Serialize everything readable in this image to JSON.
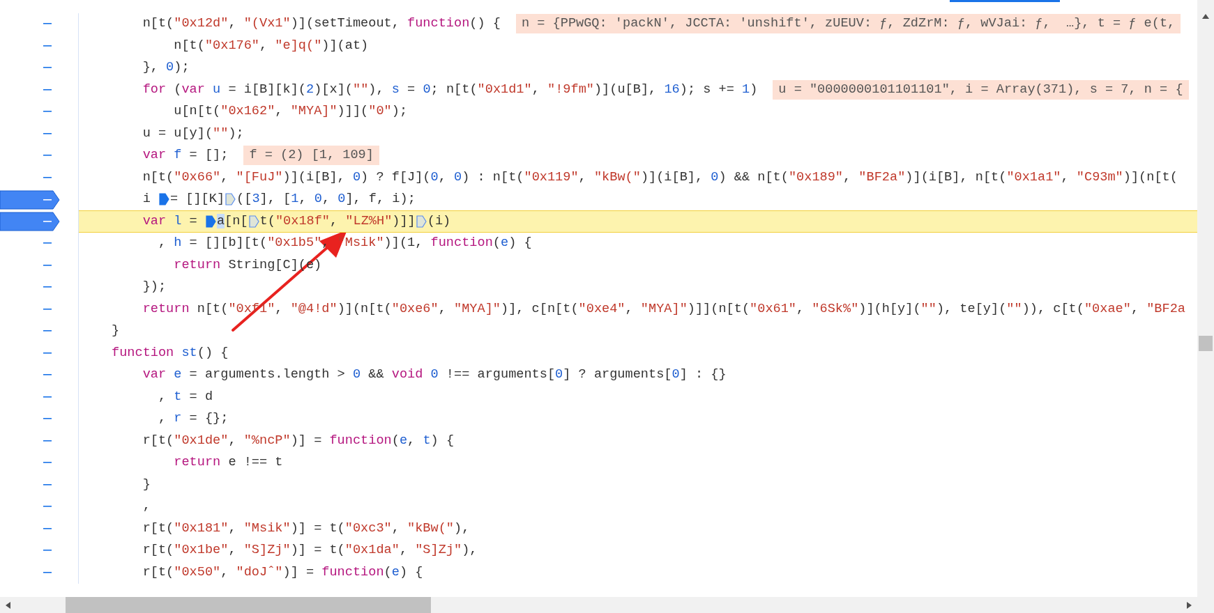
{
  "code_lines": [
    {
      "breakpoint": false,
      "current": false,
      "segments": [
        {
          "kind": "plain",
          "text": "    n[t("
        },
        {
          "kind": "string",
          "text": "\"0x12d\""
        },
        {
          "kind": "plain",
          "text": ", "
        },
        {
          "kind": "string",
          "text": "\"(Vx1\""
        },
        {
          "kind": "plain",
          "text": ")](setTimeout, "
        },
        {
          "kind": "keyword",
          "text": "function"
        },
        {
          "kind": "plain",
          "text": "() {"
        },
        {
          "kind": "value",
          "text": "n = {PPwGQ: 'packN', JCCTA: 'unshift', zUEUV: ƒ, ZdZrM: ƒ, wVJai: ƒ,  …}, t = ƒ e(t,"
        }
      ]
    },
    {
      "breakpoint": false,
      "current": false,
      "segments": [
        {
          "kind": "plain",
          "text": "        n[t("
        },
        {
          "kind": "string",
          "text": "\"0x176\""
        },
        {
          "kind": "plain",
          "text": ", "
        },
        {
          "kind": "string",
          "text": "\"e]q(\""
        },
        {
          "kind": "plain",
          "text": ")](at)"
        }
      ]
    },
    {
      "breakpoint": false,
      "current": false,
      "segments": [
        {
          "kind": "plain",
          "text": "    }, "
        },
        {
          "kind": "number",
          "text": "0"
        },
        {
          "kind": "plain",
          "text": ");"
        }
      ]
    },
    {
      "breakpoint": false,
      "current": false,
      "segments": [
        {
          "kind": "keyword",
          "text": "    for"
        },
        {
          "kind": "plain",
          "text": " ("
        },
        {
          "kind": "keyword",
          "text": "var "
        },
        {
          "kind": "name",
          "text": "u"
        },
        {
          "kind": "plain",
          "text": " = i[B][k]("
        },
        {
          "kind": "number",
          "text": "2"
        },
        {
          "kind": "plain",
          "text": ")[x]("
        },
        {
          "kind": "string",
          "text": "\"\""
        },
        {
          "kind": "plain",
          "text": "), "
        },
        {
          "kind": "name",
          "text": "s"
        },
        {
          "kind": "plain",
          "text": " = "
        },
        {
          "kind": "number",
          "text": "0"
        },
        {
          "kind": "plain",
          "text": "; n[t("
        },
        {
          "kind": "string",
          "text": "\"0x1d1\""
        },
        {
          "kind": "plain",
          "text": ", "
        },
        {
          "kind": "string",
          "text": "\"!9fm\""
        },
        {
          "kind": "plain",
          "text": ")](u[B], "
        },
        {
          "kind": "number",
          "text": "16"
        },
        {
          "kind": "plain",
          "text": "); s += "
        },
        {
          "kind": "number",
          "text": "1"
        },
        {
          "kind": "plain",
          "text": ")"
        },
        {
          "kind": "value",
          "text": "u = \"0000000101101101\", i = Array(371), s = 7, n = {"
        }
      ]
    },
    {
      "breakpoint": false,
      "current": false,
      "segments": [
        {
          "kind": "plain",
          "text": "        u[n[t("
        },
        {
          "kind": "string",
          "text": "\"0x162\""
        },
        {
          "kind": "plain",
          "text": ", "
        },
        {
          "kind": "string",
          "text": "\"MYA]\""
        },
        {
          "kind": "plain",
          "text": ")]]("
        },
        {
          "kind": "string",
          "text": "\"0\""
        },
        {
          "kind": "plain",
          "text": ");"
        }
      ]
    },
    {
      "breakpoint": false,
      "current": false,
      "segments": [
        {
          "kind": "plain",
          "text": "    u = u[y]("
        },
        {
          "kind": "string",
          "text": "\"\""
        },
        {
          "kind": "plain",
          "text": ");"
        }
      ]
    },
    {
      "breakpoint": false,
      "current": false,
      "segments": [
        {
          "kind": "keyword",
          "text": "    var "
        },
        {
          "kind": "name",
          "text": "f"
        },
        {
          "kind": "plain",
          "text": " = [];"
        },
        {
          "kind": "value",
          "text": "f = (2) [1, 109]"
        }
      ]
    },
    {
      "breakpoint": false,
      "current": false,
      "segments": [
        {
          "kind": "plain",
          "text": "    n[t("
        },
        {
          "kind": "string",
          "text": "\"0x66\""
        },
        {
          "kind": "plain",
          "text": ", "
        },
        {
          "kind": "string",
          "text": "\"[FuJ\""
        },
        {
          "kind": "plain",
          "text": ")](i[B], "
        },
        {
          "kind": "number",
          "text": "0"
        },
        {
          "kind": "plain",
          "text": ") ? f[J]("
        },
        {
          "kind": "number",
          "text": "0"
        },
        {
          "kind": "plain",
          "text": ", "
        },
        {
          "kind": "number",
          "text": "0"
        },
        {
          "kind": "plain",
          "text": ") : n[t("
        },
        {
          "kind": "string",
          "text": "\"0x119\""
        },
        {
          "kind": "plain",
          "text": ", "
        },
        {
          "kind": "string",
          "text": "\"kBw(\""
        },
        {
          "kind": "plain",
          "text": ")](i[B], "
        },
        {
          "kind": "number",
          "text": "0"
        },
        {
          "kind": "plain",
          "text": ") && n[t("
        },
        {
          "kind": "string",
          "text": "\"0x189\""
        },
        {
          "kind": "plain",
          "text": ", "
        },
        {
          "kind": "string",
          "text": "\"BF2a\""
        },
        {
          "kind": "plain",
          "text": ")](i[B], n[t("
        },
        {
          "kind": "string",
          "text": "\"0x1a1\""
        },
        {
          "kind": "plain",
          "text": ", "
        },
        {
          "kind": "string",
          "text": "\"C93m\""
        },
        {
          "kind": "plain",
          "text": ")](n[t("
        }
      ]
    },
    {
      "breakpoint": true,
      "current": false,
      "segments": [
        {
          "kind": "plain",
          "text": "    i "
        },
        {
          "kind": "marker",
          "filled": true
        },
        {
          "kind": "plain",
          "text": "= [][K]"
        },
        {
          "kind": "marker",
          "filled": false
        },
        {
          "kind": "plain",
          "text": "(["
        },
        {
          "kind": "number",
          "text": "3"
        },
        {
          "kind": "plain",
          "text": "], ["
        },
        {
          "kind": "number",
          "text": "1"
        },
        {
          "kind": "plain",
          "text": ", "
        },
        {
          "kind": "number",
          "text": "0"
        },
        {
          "kind": "plain",
          "text": ", "
        },
        {
          "kind": "number",
          "text": "0"
        },
        {
          "kind": "plain",
          "text": "], f, i);"
        }
      ]
    },
    {
      "breakpoint": true,
      "current": true,
      "segments": [
        {
          "kind": "keyword",
          "text": "    var "
        },
        {
          "kind": "name",
          "text": "l"
        },
        {
          "kind": "plain",
          "text": " = "
        },
        {
          "kind": "marker",
          "filled": true
        },
        {
          "kind": "selection",
          "text": "a"
        },
        {
          "kind": "plain",
          "text": "[n["
        },
        {
          "kind": "marker",
          "filled": false
        },
        {
          "kind": "plain",
          "text": "t("
        },
        {
          "kind": "string",
          "text": "\"0x18f\""
        },
        {
          "kind": "plain",
          "text": ", "
        },
        {
          "kind": "string",
          "text": "\"LZ%H\""
        },
        {
          "kind": "plain",
          "text": ")]]"
        },
        {
          "kind": "marker",
          "filled": false
        },
        {
          "kind": "plain",
          "text": "(i)"
        }
      ]
    },
    {
      "breakpoint": false,
      "current": false,
      "segments": [
        {
          "kind": "plain",
          "text": "      , "
        },
        {
          "kind": "name",
          "text": "h"
        },
        {
          "kind": "plain",
          "text": " = [][b][t("
        },
        {
          "kind": "string",
          "text": "\"0x1b5\""
        },
        {
          "kind": "plain",
          "text": ", "
        },
        {
          "kind": "string",
          "text": "\"Msik\""
        },
        {
          "kind": "plain",
          "text": ")](1, "
        },
        {
          "kind": "keyword",
          "text": "function"
        },
        {
          "kind": "plain",
          "text": "("
        },
        {
          "kind": "name",
          "text": "e"
        },
        {
          "kind": "plain",
          "text": ") {"
        }
      ]
    },
    {
      "breakpoint": false,
      "current": false,
      "segments": [
        {
          "kind": "keyword",
          "text": "        return"
        },
        {
          "kind": "plain",
          "text": " String[C](e)"
        }
      ]
    },
    {
      "breakpoint": false,
      "current": false,
      "segments": [
        {
          "kind": "plain",
          "text": "    });"
        }
      ]
    },
    {
      "breakpoint": false,
      "current": false,
      "segments": [
        {
          "kind": "keyword",
          "text": "    return"
        },
        {
          "kind": "plain",
          "text": " n[t("
        },
        {
          "kind": "string",
          "text": "\"0xf1\""
        },
        {
          "kind": "plain",
          "text": ", "
        },
        {
          "kind": "string",
          "text": "\"@4!d\""
        },
        {
          "kind": "plain",
          "text": ")](n[t("
        },
        {
          "kind": "string",
          "text": "\"0xe6\""
        },
        {
          "kind": "plain",
          "text": ", "
        },
        {
          "kind": "string",
          "text": "\"MYA]\""
        },
        {
          "kind": "plain",
          "text": ")], c[n[t("
        },
        {
          "kind": "string",
          "text": "\"0xe4\""
        },
        {
          "kind": "plain",
          "text": ", "
        },
        {
          "kind": "string",
          "text": "\"MYA]\""
        },
        {
          "kind": "plain",
          "text": ")]](n[t("
        },
        {
          "kind": "string",
          "text": "\"0x61\""
        },
        {
          "kind": "plain",
          "text": ", "
        },
        {
          "kind": "string",
          "text": "\"6Sk%\""
        },
        {
          "kind": "plain",
          "text": ")](h[y]("
        },
        {
          "kind": "string",
          "text": "\"\""
        },
        {
          "kind": "plain",
          "text": "), te[y]("
        },
        {
          "kind": "string",
          "text": "\"\""
        },
        {
          "kind": "plain",
          "text": ")), c[t("
        },
        {
          "kind": "string",
          "text": "\"0xae\""
        },
        {
          "kind": "plain",
          "text": ", "
        },
        {
          "kind": "string",
          "text": "\"BF2a"
        }
      ]
    },
    {
      "breakpoint": false,
      "current": false,
      "segments": [
        {
          "kind": "plain",
          "text": "}"
        }
      ]
    },
    {
      "breakpoint": false,
      "current": false,
      "segments": [
        {
          "kind": "keyword",
          "text": "function "
        },
        {
          "kind": "name",
          "text": "st"
        },
        {
          "kind": "plain",
          "text": "() {"
        }
      ]
    },
    {
      "breakpoint": false,
      "current": false,
      "segments": [
        {
          "kind": "keyword",
          "text": "    var "
        },
        {
          "kind": "name",
          "text": "e"
        },
        {
          "kind": "plain",
          "text": " = arguments.length > "
        },
        {
          "kind": "number",
          "text": "0"
        },
        {
          "kind": "plain",
          "text": " && "
        },
        {
          "kind": "keyword",
          "text": "void "
        },
        {
          "kind": "number",
          "text": "0"
        },
        {
          "kind": "plain",
          "text": " !== arguments["
        },
        {
          "kind": "number",
          "text": "0"
        },
        {
          "kind": "plain",
          "text": "] ? arguments["
        },
        {
          "kind": "number",
          "text": "0"
        },
        {
          "kind": "plain",
          "text": "] : {}"
        }
      ]
    },
    {
      "breakpoint": false,
      "current": false,
      "segments": [
        {
          "kind": "plain",
          "text": "      , "
        },
        {
          "kind": "name",
          "text": "t"
        },
        {
          "kind": "plain",
          "text": " = d"
        }
      ]
    },
    {
      "breakpoint": false,
      "current": false,
      "segments": [
        {
          "kind": "plain",
          "text": "      , "
        },
        {
          "kind": "name",
          "text": "r"
        },
        {
          "kind": "plain",
          "text": " = {};"
        }
      ]
    },
    {
      "breakpoint": false,
      "current": false,
      "segments": [
        {
          "kind": "plain",
          "text": "    r[t("
        },
        {
          "kind": "string",
          "text": "\"0x1de\""
        },
        {
          "kind": "plain",
          "text": ", "
        },
        {
          "kind": "string",
          "text": "\"%ncP\""
        },
        {
          "kind": "plain",
          "text": ")] = "
        },
        {
          "kind": "keyword",
          "text": "function"
        },
        {
          "kind": "plain",
          "text": "("
        },
        {
          "kind": "name",
          "text": "e"
        },
        {
          "kind": "plain",
          "text": ", "
        },
        {
          "kind": "name",
          "text": "t"
        },
        {
          "kind": "plain",
          "text": ") {"
        }
      ]
    },
    {
      "breakpoint": false,
      "current": false,
      "segments": [
        {
          "kind": "keyword",
          "text": "        return"
        },
        {
          "kind": "plain",
          "text": " e !== t"
        }
      ]
    },
    {
      "breakpoint": false,
      "current": false,
      "segments": [
        {
          "kind": "plain",
          "text": "    }"
        }
      ]
    },
    {
      "breakpoint": false,
      "current": false,
      "segments": [
        {
          "kind": "plain",
          "text": "    ,"
        }
      ]
    },
    {
      "breakpoint": false,
      "current": false,
      "segments": [
        {
          "kind": "plain",
          "text": "    r[t("
        },
        {
          "kind": "string",
          "text": "\"0x181\""
        },
        {
          "kind": "plain",
          "text": ", "
        },
        {
          "kind": "string",
          "text": "\"Msik\""
        },
        {
          "kind": "plain",
          "text": ")] = t("
        },
        {
          "kind": "string",
          "text": "\"0xc3\""
        },
        {
          "kind": "plain",
          "text": ", "
        },
        {
          "kind": "string",
          "text": "\"kBw(\""
        },
        {
          "kind": "plain",
          "text": "),"
        }
      ]
    },
    {
      "breakpoint": false,
      "current": false,
      "segments": [
        {
          "kind": "plain",
          "text": "    r[t("
        },
        {
          "kind": "string",
          "text": "\"0x1be\""
        },
        {
          "kind": "plain",
          "text": ", "
        },
        {
          "kind": "string",
          "text": "\"S]Zj\""
        },
        {
          "kind": "plain",
          "text": ")] = t("
        },
        {
          "kind": "string",
          "text": "\"0x1da\""
        },
        {
          "kind": "plain",
          "text": ", "
        },
        {
          "kind": "string",
          "text": "\"S]Zj\""
        },
        {
          "kind": "plain",
          "text": "),"
        }
      ]
    },
    {
      "breakpoint": false,
      "current": false,
      "segments": [
        {
          "kind": "plain",
          "text": "    r[t("
        },
        {
          "kind": "string",
          "text": "\"0x50\""
        },
        {
          "kind": "plain",
          "text": ", "
        },
        {
          "kind": "string",
          "text": "\"doJˆ\""
        },
        {
          "kind": "plain",
          "text": ")] = "
        },
        {
          "kind": "keyword",
          "text": "function"
        },
        {
          "kind": "plain",
          "text": "("
        },
        {
          "kind": "name",
          "text": "e"
        },
        {
          "kind": "plain",
          "text": ") {"
        }
      ]
    }
  ]
}
